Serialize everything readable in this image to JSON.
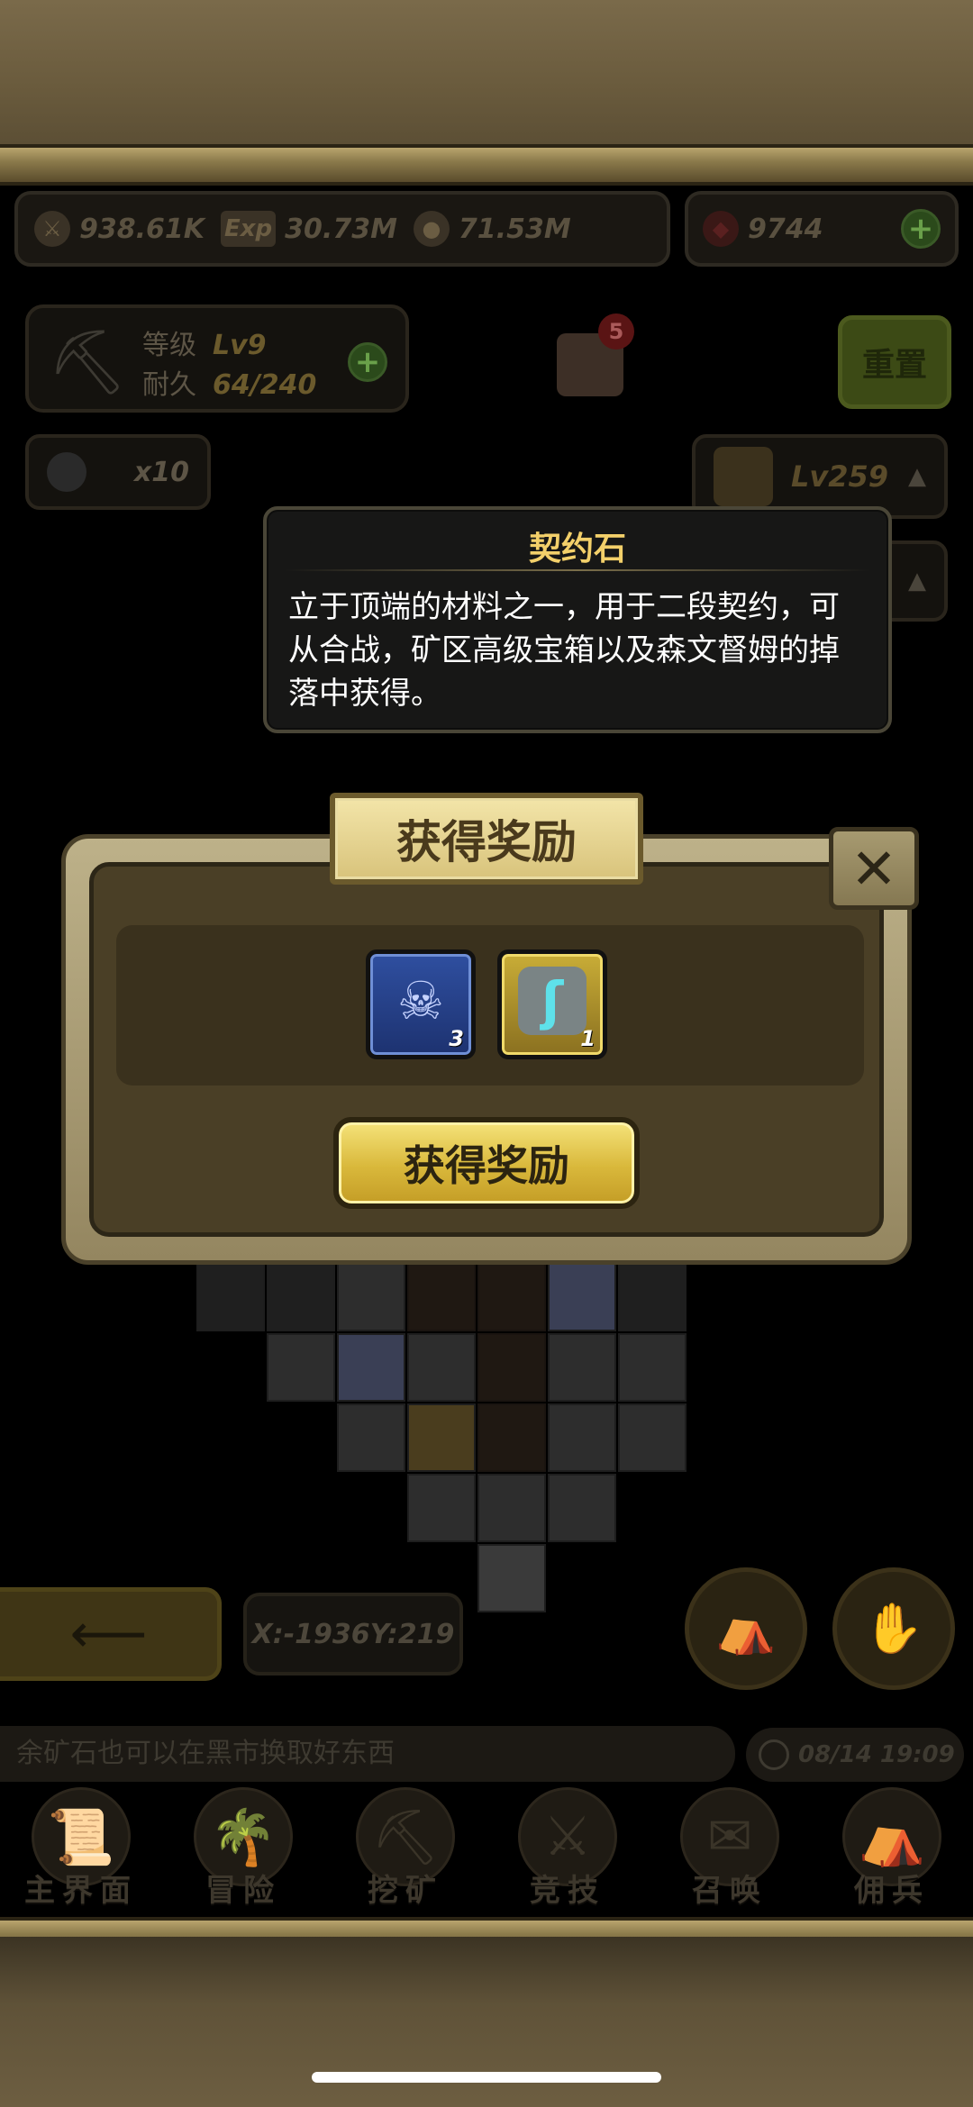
{
  "resources": {
    "attack": "938.61K",
    "exp_label": "Exp",
    "exp": "30.73M",
    "gold": "71.53M",
    "gems": "9744"
  },
  "pickaxe": {
    "level_label": "等级",
    "level": "Lv9",
    "durability_label": "耐久",
    "durability": "64/240"
  },
  "chest_badge": "5",
  "reset_label": "重置",
  "bombs": "x10",
  "hero_level": "Lv259",
  "tooltip": {
    "title": "契约石",
    "text": "立于顶端的材料之一，用于二段契约，可从合战，矿区高级宝箱以及森文督姆的掉落中获得。"
  },
  "reward_dialog": {
    "title": "获得奖励",
    "items": [
      {
        "icon": "demon-mask-icon",
        "count": "3"
      },
      {
        "icon": "contract-stone-icon",
        "count": "1"
      }
    ],
    "claim_label": "获得奖励",
    "close_label": "✕"
  },
  "coordinates": "X:-1936Y:219",
  "ticker": "余矿石也可以在黑市换取好东西",
  "datetime": "08/14 19:09",
  "nav": [
    {
      "label": "主界面",
      "icon": "scroll-icon"
    },
    {
      "label": "冒险",
      "icon": "island-icon"
    },
    {
      "label": "挖矿",
      "icon": "pickaxe-icon"
    },
    {
      "label": "竞技",
      "icon": "swords-icon"
    },
    {
      "label": "召唤",
      "icon": "summon-scroll-icon"
    },
    {
      "label": "佣兵",
      "icon": "tent-icon"
    }
  ]
}
